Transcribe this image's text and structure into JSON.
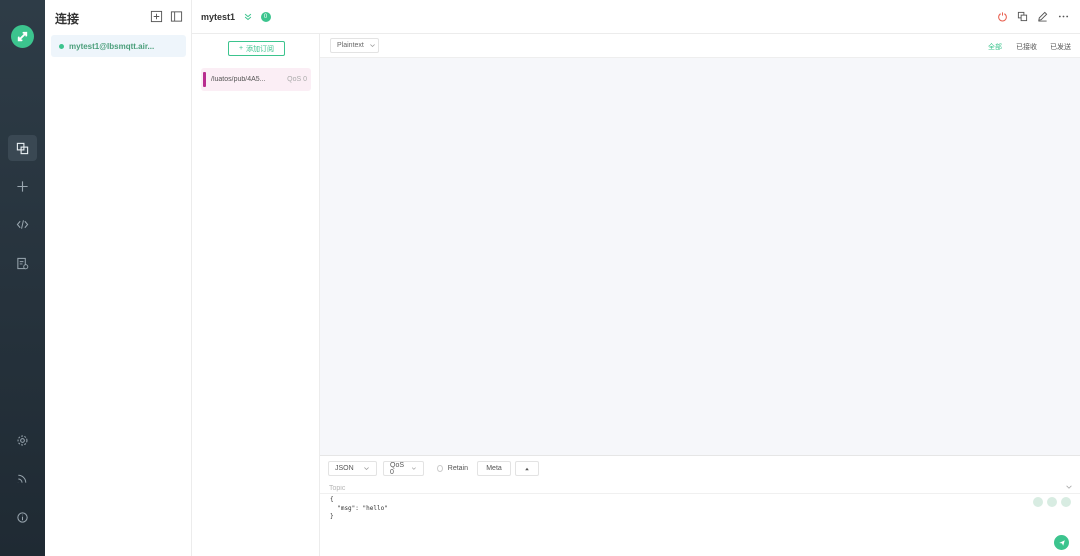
{
  "sidebar": {
    "nav": [
      "connections-icon",
      "plus-icon",
      "code-icon",
      "log-icon",
      "settings-icon",
      "feed-icon",
      "info-icon"
    ]
  },
  "connections": {
    "title": "连接",
    "items": [
      {
        "name": "mytest1@lbsmqtt.air...",
        "status": "connected"
      }
    ]
  },
  "topbar": {
    "title": "mytest1",
    "badge_count": "0"
  },
  "subscriptions": {
    "add_label": "添加订阅",
    "items": [
      {
        "topic": "/luatos/pub/4A5...",
        "qos": "QoS 0",
        "color": "#b82d8f"
      }
    ]
  },
  "messages": {
    "format": "Plaintext",
    "filters": [
      "全部",
      "已接收",
      "已发送"
    ],
    "active_filter": "全部"
  },
  "publish": {
    "payload_type": "JSON",
    "qos": "QoS 0",
    "retain_label": "Retain",
    "meta_label": "Meta",
    "topic_placeholder": "Topic",
    "payload": "{\n  \"msg\": \"hello\"\n}"
  },
  "colors": {
    "accent": "#3cc48e",
    "sidebar": "#25323c"
  }
}
